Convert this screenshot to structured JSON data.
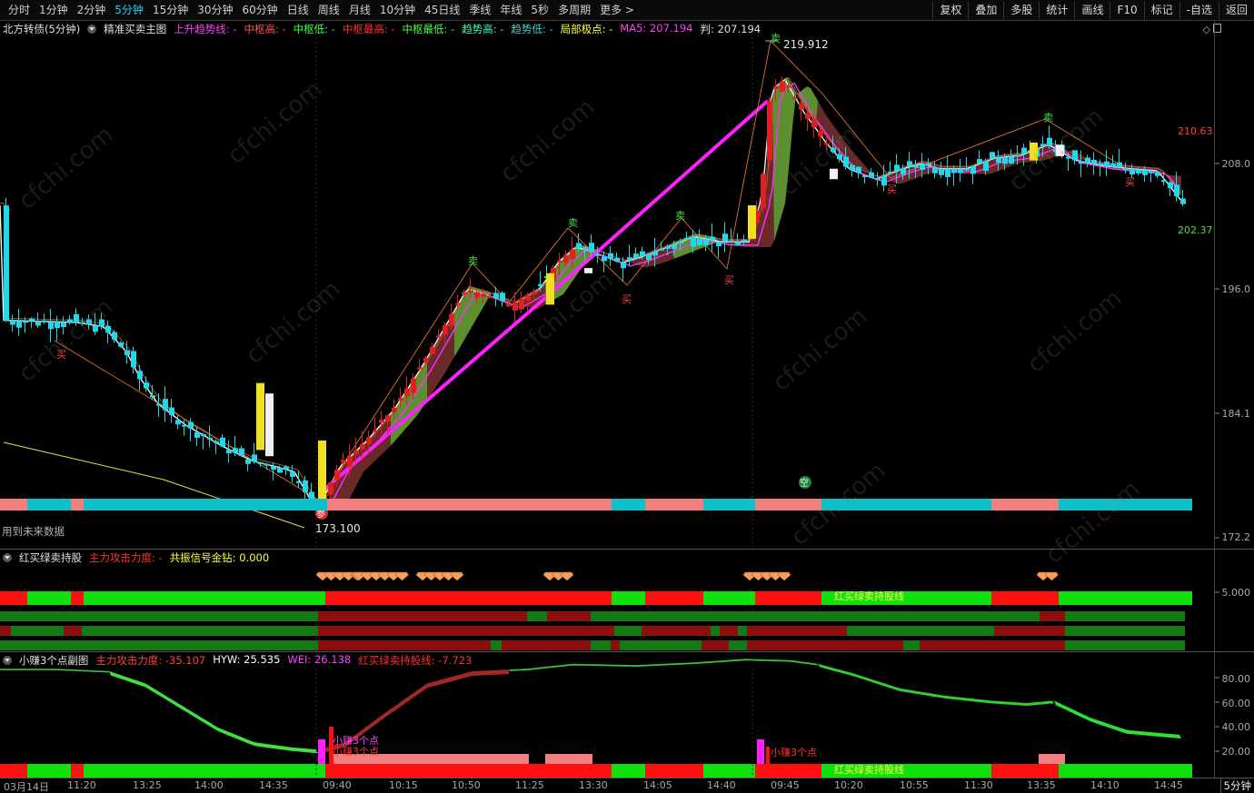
{
  "toolbar": {
    "periods": [
      "分时",
      "1分钟",
      "2分钟",
      "5分钟",
      "15分钟",
      "30分钟",
      "60分钟",
      "日线",
      "周线",
      "月线",
      "10分钟",
      "45日线",
      "季线",
      "年线",
      "5秒",
      "多周期",
      "更多 >"
    ],
    "active_period": "5分钟",
    "tools": [
      "复权",
      "叠加",
      "多股",
      "统计",
      "画线",
      "F10",
      "标记",
      "-自选",
      "返回"
    ]
  },
  "main": {
    "security": "北方转债(5分钟)",
    "indicator": "精准买卖主图",
    "fields": [
      {
        "label": "上升趋势线:",
        "value": "-",
        "color": "#ff40ff"
      },
      {
        "label": "中枢高:",
        "value": "-",
        "color": "#ff5050"
      },
      {
        "label": "中枢低:",
        "value": "-",
        "color": "#40ff40"
      },
      {
        "label": "中枢最高:",
        "value": "-",
        "color": "#ff3030"
      },
      {
        "label": "中枢最低:",
        "value": "-",
        "color": "#40ff40"
      },
      {
        "label": "趋势高:",
        "value": "-",
        "color": "#40ffb0"
      },
      {
        "label": "趋势低:",
        "value": "-",
        "color": "#40d0d0"
      },
      {
        "label": "局部极点:",
        "value": "-",
        "color": "#ffff40"
      },
      {
        "label": "MA5:",
        "value": "207.194",
        "color": "#ff40ff"
      },
      {
        "label": "判:",
        "value": "207.194",
        "color": "#e0e0e0"
      }
    ],
    "high_label": "219.912",
    "low_label": "173.100",
    "future_note": "用到未来数据",
    "axis": [
      "208.0",
      "196.0",
      "184.1",
      "172.2"
    ],
    "upper_level": "210.63",
    "lower_level": "202.37",
    "markers": {
      "buy": "买",
      "sell": "卖",
      "empty": "空",
      "join": "参"
    }
  },
  "signal": {
    "name": "红买绿卖持股",
    "fields": [
      {
        "label": "主力攻击力度:",
        "value": "-",
        "color": "#ff3030"
      },
      {
        "label": "共振信号金钻:",
        "value": "0.000",
        "color": "#ffff40"
      }
    ],
    "axis": [
      "5.000"
    ],
    "line_label": "红买绿卖持股线"
  },
  "sub": {
    "name": "小赚3个点副图",
    "fields": [
      {
        "label": "主力攻击力度:",
        "value": "-35.107",
        "color": "#ff4040"
      },
      {
        "label": "HYW:",
        "value": "25.535",
        "color": "#ffffff"
      },
      {
        "label": "WEI:",
        "value": "26.138",
        "color": "#ff40ff"
      },
      {
        "label": "红买绿卖持股线:",
        "value": "-7.723",
        "color": "#ff3030"
      }
    ],
    "axis": [
      "80.00",
      "60.00",
      "40.00",
      "20.00"
    ],
    "tag": "小赚3个点",
    "line_label": "红买绿卖持股线"
  },
  "time_axis": {
    "labels": [
      "03月14日",
      "11:20",
      "13:25",
      "14:00",
      "14:35",
      "09:40",
      "10:15",
      "10:50",
      "11:25",
      "13:30",
      "14:05",
      "14:40",
      "09:45",
      "10:20",
      "10:55",
      "11:30",
      "13:35",
      "14:10",
      "14:45"
    ],
    "period": "5分钟"
  },
  "watermark": "cfchi.com"
}
